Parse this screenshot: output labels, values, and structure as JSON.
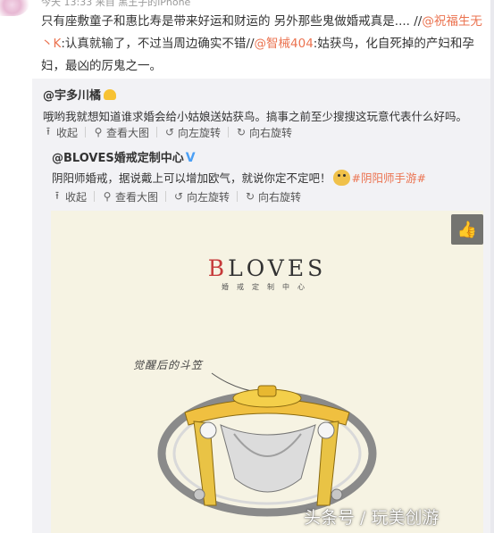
{
  "post": {
    "meta": "今天 13:33 来自 黑王子的iPhone",
    "text_a": "只有座敷童子和惠比寿是带来好运和财运的 另外那些鬼做婚戒真是.... //",
    "mention_1": "@祝福生无丶K",
    "text_b": ":认真就输了，不过当周边确实不错//",
    "mention_2": "@智械404",
    "text_c": ":姑获鸟，化自死掉的产妇和孕妇，最凶的厉鬼之一。"
  },
  "repost": {
    "user": "@宇多川橘",
    "text": "哦哟我就想知道谁求婚会给小姑娘送姑获鸟。搞事之前至少搜搜这玩意代表什么好吗。",
    "toolbar": {
      "collapse": "收起",
      "view_large": "查看大图",
      "rotate_left": "向左旋转",
      "rotate_right": "向右旋转"
    }
  },
  "inner": {
    "user": "@BLOVES婚戒定制中心",
    "verified": "V",
    "text": "阴阳师婚戒，据说戴上可以增加欧气，就说你定不定吧！",
    "hashtag": "#阴阳师手游#",
    "toolbar": {
      "collapse": "收起",
      "view_large": "查看大图",
      "rotate_left": "向左旋转",
      "rotate_right": "向右旋转"
    }
  },
  "artwork": {
    "brand_first": "B",
    "brand_rest": "LOVES",
    "brand_sub": "婚戒定制中心",
    "hand_label": "觉醒后的斗笠"
  },
  "watermark": "头条号 / 玩美创游",
  "colors": {
    "link": "#eb7350",
    "repost_bg": "#f2f2f5",
    "verified": "#4a9ff5",
    "ring_gold": "#f0c040"
  },
  "icons": [
    "upload-icon",
    "search-icon",
    "rotate-left-icon",
    "rotate-right-icon",
    "thumbs-up-icon",
    "dog-emoji-icon"
  ]
}
